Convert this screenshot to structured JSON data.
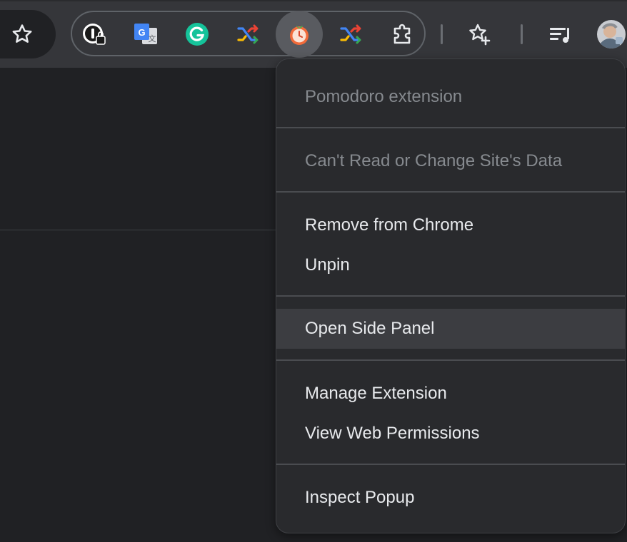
{
  "toolbar": {
    "bookmark_icon": "star-outline-icon",
    "extensions": [
      {
        "name": "1password-icon",
        "active": false
      },
      {
        "name": "google-translate-icon",
        "active": false
      },
      {
        "name": "grammarly-icon",
        "active": false
      },
      {
        "name": "shuffle-icon",
        "active": false
      },
      {
        "name": "pomodoro-icon",
        "active": true
      },
      {
        "name": "shuffle-icon",
        "active": false
      },
      {
        "name": "puzzle-extensions-icon",
        "active": false
      }
    ],
    "reading_list_icon": "star-plus-icon",
    "media_icon": "media-playlist-icon",
    "avatar_icon": "profile-avatar"
  },
  "context_menu": {
    "title": "Pomodoro extension",
    "site_access": "Can't Read or Change Site's Data",
    "remove": "Remove from Chrome",
    "unpin": "Unpin",
    "open_side_panel": "Open Side Panel",
    "manage": "Manage Extension",
    "permissions": "View Web Permissions",
    "inspect": "Inspect Popup"
  },
  "colors": {
    "toolbar_bg": "#35363a",
    "page_bg": "#202124",
    "menu_bg": "#292a2d",
    "menu_hover": "#3c3d41",
    "text": "#e8eaed",
    "text_disabled": "#868a8f"
  }
}
